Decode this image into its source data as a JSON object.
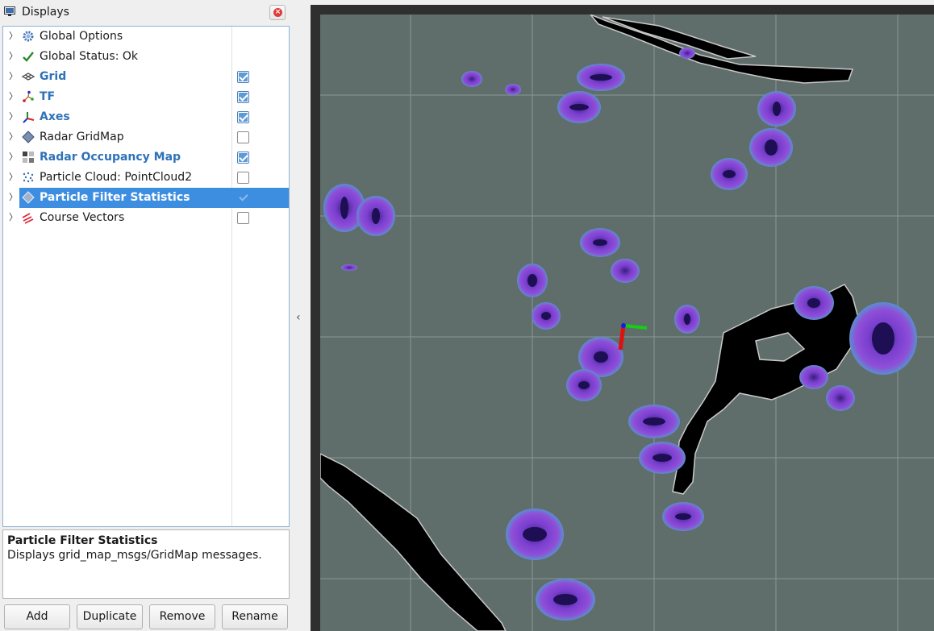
{
  "window": {
    "title": "Displays"
  },
  "tree": {
    "items": [
      {
        "label": "Global Options",
        "icon": "gear-icon",
        "bold": false,
        "checkbox": null
      },
      {
        "label": "Global Status: Ok",
        "icon": "checkmark-icon",
        "bold": false,
        "checkbox": null
      },
      {
        "label": "Grid",
        "icon": "grid-icon",
        "bold": true,
        "checkbox": true
      },
      {
        "label": "TF",
        "icon": "tf-icon",
        "bold": true,
        "checkbox": true
      },
      {
        "label": "Axes",
        "icon": "axes-icon",
        "bold": true,
        "checkbox": true
      },
      {
        "label": "Radar GridMap",
        "icon": "gridmap-icon",
        "bold": false,
        "checkbox": false
      },
      {
        "label": "Radar Occupancy Map",
        "icon": "occupancy-map-icon",
        "bold": true,
        "checkbox": true
      },
      {
        "label": "Particle Cloud: PointCloud2",
        "icon": "pointcloud-icon",
        "bold": false,
        "checkbox": false
      },
      {
        "label": "Particle Filter Statistics",
        "icon": "gridmap-icon",
        "bold": true,
        "checkbox": true,
        "selected": true
      },
      {
        "label": "Course Vectors",
        "icon": "vectors-icon",
        "bold": false,
        "checkbox": false
      }
    ]
  },
  "description": {
    "title": "Particle Filter Statistics",
    "text": "Displays grid_map_msgs/GridMap messages."
  },
  "buttons": {
    "add": "Add",
    "duplicate": "Duplicate",
    "remove": "Remove",
    "rename": "Rename"
  },
  "colors": {
    "selection": "#3d8ee0",
    "bold_label": "#2e72b8",
    "map_background": "#5f6d6b",
    "particle_purple": "#8a3fd0",
    "obstacle_black": "#000000"
  }
}
